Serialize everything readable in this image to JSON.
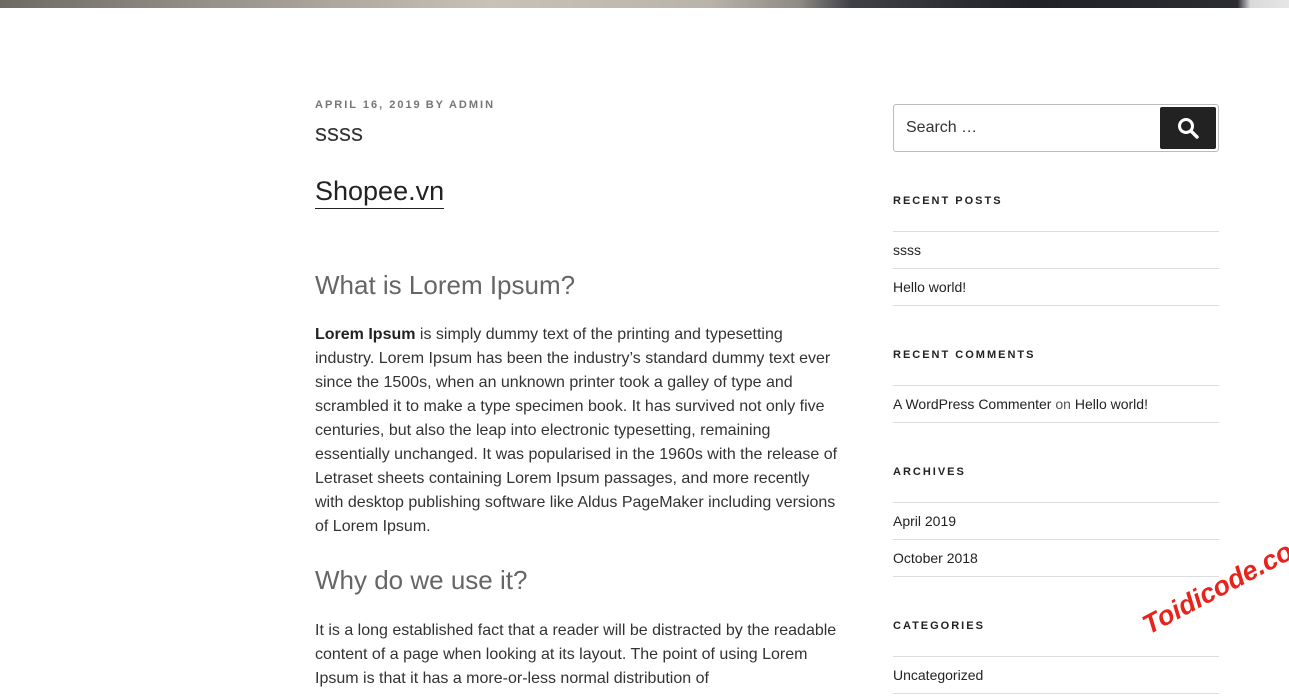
{
  "post": {
    "meta_date": "APRIL 16, 2019",
    "meta_by": "BY",
    "meta_author": "ADMIN",
    "title": "ssss",
    "link_text": "Shopee.vn",
    "heading1": "What is Lorem Ipsum?",
    "para1_bold": "Lorem Ipsum",
    "para1_rest": " is simply dummy text of the printing and typesetting industry. Lorem Ipsum has been the industry’s standard dummy text ever since the 1500s, when an unknown printer took a galley of type and scrambled it to make a type specimen book. It has survived not only five centuries, but also the leap into electronic typesetting, remaining essentially unchanged. It was popularised in the 1960s with the release of Letraset sheets containing Lorem Ipsum passages, and more recently with desktop publishing software like Aldus PageMaker including versions of Lorem Ipsum.",
    "heading2": "Why do we use it?",
    "para2": "It is a long established fact that a reader will be distracted by the readable content of a page when looking at its layout. The point of using Lorem Ipsum is that it has a more-or-less normal distribution of"
  },
  "sidebar": {
    "search_placeholder": "Search …",
    "search_icon": "search-icon",
    "recent_posts": {
      "title": "RECENT POSTS",
      "items": [
        "ssss",
        "Hello world!"
      ]
    },
    "recent_comments": {
      "title": "RECENT COMMENTS",
      "author": "A WordPress Commenter",
      "on": "on",
      "post": "Hello world!"
    },
    "archives": {
      "title": "ARCHIVES",
      "items": [
        "April 2019",
        "October 2018"
      ]
    },
    "categories": {
      "title": "CATEGORIES",
      "items": [
        "Uncategorized"
      ]
    }
  },
  "watermark": "Toidicode.com",
  "colors": {
    "text": "#333333",
    "heading": "#666666",
    "meta": "#767676",
    "button_bg": "#222222",
    "divider": "#dddddd",
    "watermark": "#e8231c"
  }
}
